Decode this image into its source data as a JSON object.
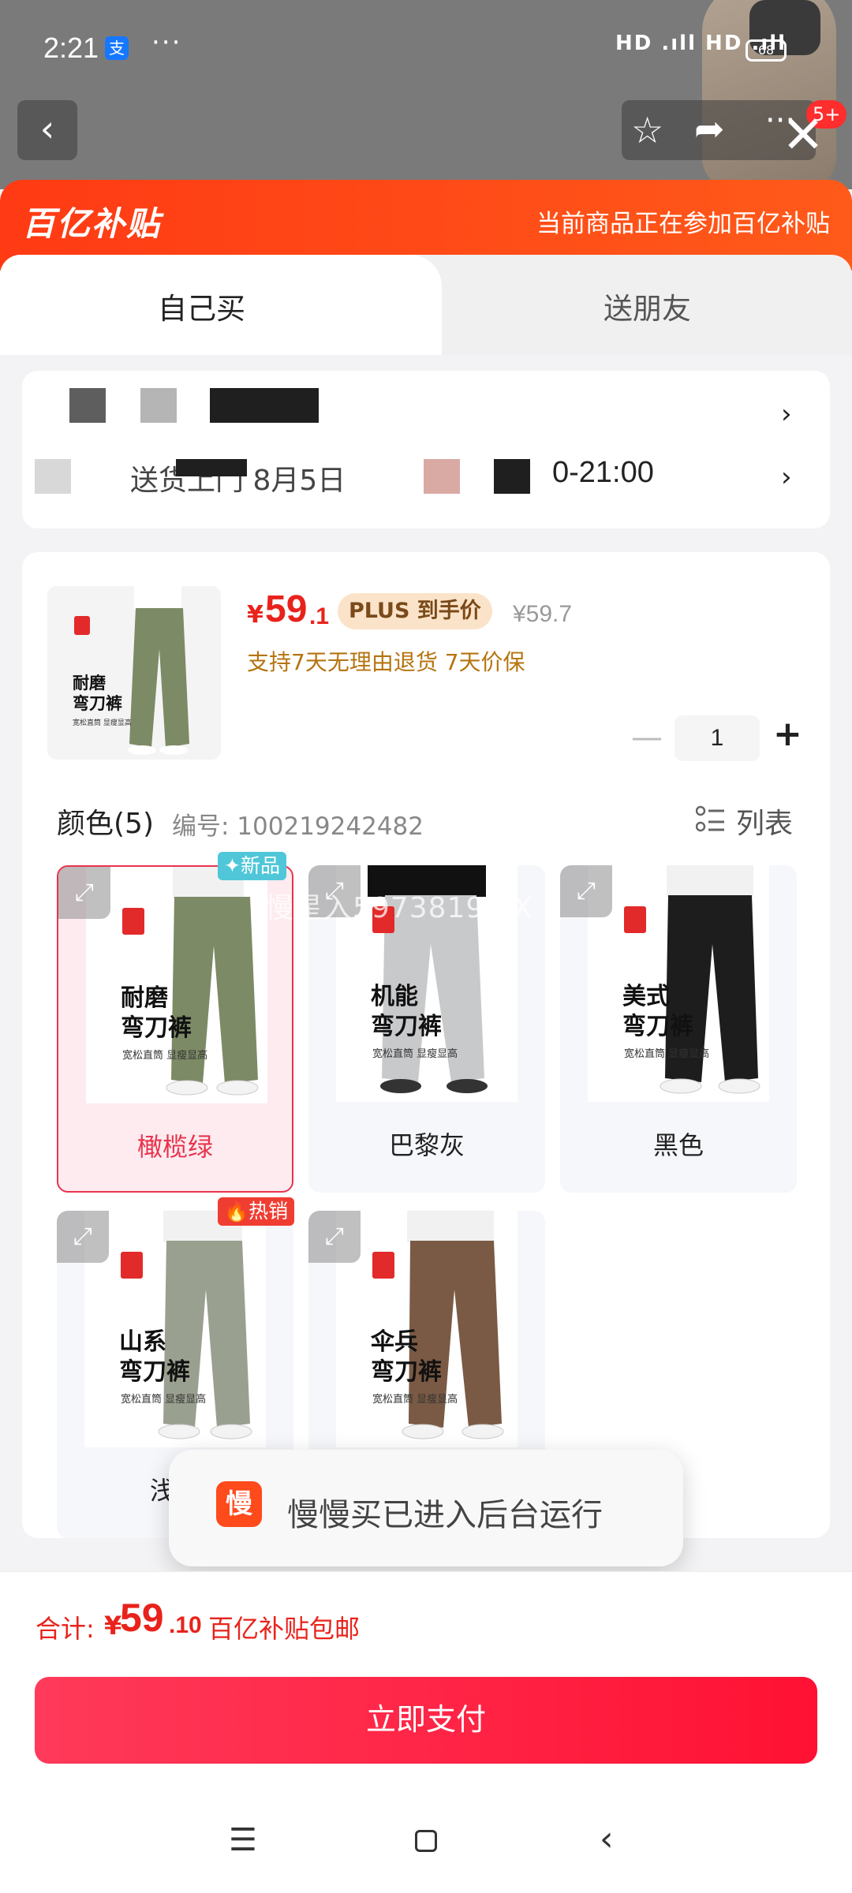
{
  "status_bar": {
    "time": "2:21",
    "alipay_icon": "支",
    "dots": "···",
    "signal": "HD .ıll HD .ıll",
    "battery": "68"
  },
  "background_page": {
    "cart_badge": "5+"
  },
  "banner": {
    "logo": "百亿补贴",
    "text": "当前商品正在参加百亿补贴"
  },
  "tabs": [
    {
      "label": "自己买",
      "active": true
    },
    {
      "label": "送朋友",
      "active": false
    }
  ],
  "address": {
    "delivery_time_partial": "送货上门 8月5日",
    "delivery_time_end": "0-21:00"
  },
  "product": {
    "price_symbol": "¥",
    "price_int": "59",
    "price_dec": ".1",
    "plus_badge": "PLUS 到手价",
    "original_price": "¥59.7",
    "service": "支持7天无理由退货  7天价保",
    "quantity": "1"
  },
  "color_section": {
    "title": "颜色(5)",
    "code": "编号: 100219242482",
    "list_label": "列表",
    "watermark": "慢星入5973819T X"
  },
  "variants": [
    {
      "name": "橄榄绿",
      "line1": "耐磨",
      "line2": "弯刀裤",
      "sub": "宽松直筒 显瘦显高",
      "color": "#7c8a66",
      "tag": "✦新品",
      "selected": true
    },
    {
      "name": "巴黎灰",
      "line1": "机能",
      "line2": "弯刀裤",
      "sub": "宽松直筒 显瘦显高",
      "color": "#c8c9cb",
      "tag": "",
      "selected": false
    },
    {
      "name": "黑色",
      "line1": "美式",
      "line2": "弯刀裤",
      "sub": "宽松直筒 显瘦显高",
      "color": "#1d1d1d",
      "tag": "",
      "selected": false
    },
    {
      "name": "浅",
      "line1": "山系",
      "line2": "弯刀裤",
      "sub": "宽松直筒 显瘦显高",
      "color": "#9aa08f",
      "tag": "热销",
      "selected": false
    },
    {
      "name": "",
      "line1": "伞兵",
      "line2": "弯刀裤",
      "sub": "宽松直筒 显瘦显高",
      "color": "#7a5a44",
      "tag": "",
      "selected": false
    }
  ],
  "main_thumb": {
    "line1": "耐磨",
    "line2": "弯刀裤",
    "sub": "宽松直筒 显瘦显高"
  },
  "toast": {
    "icon": "慢",
    "text": "慢慢买已进入后台运行"
  },
  "footer": {
    "total_label": "合计:",
    "total_symbol": "¥",
    "total_int": "59",
    "total_dec": ".10",
    "shipping": "百亿补贴包邮",
    "pay_button": "立即支付"
  },
  "nav": {
    "menu": "☰",
    "back": "‹"
  },
  "colors": {
    "accent": "#e8231b",
    "banner": "#ff3a14",
    "selected_border": "#e8344f",
    "pay": "#ff1133"
  }
}
